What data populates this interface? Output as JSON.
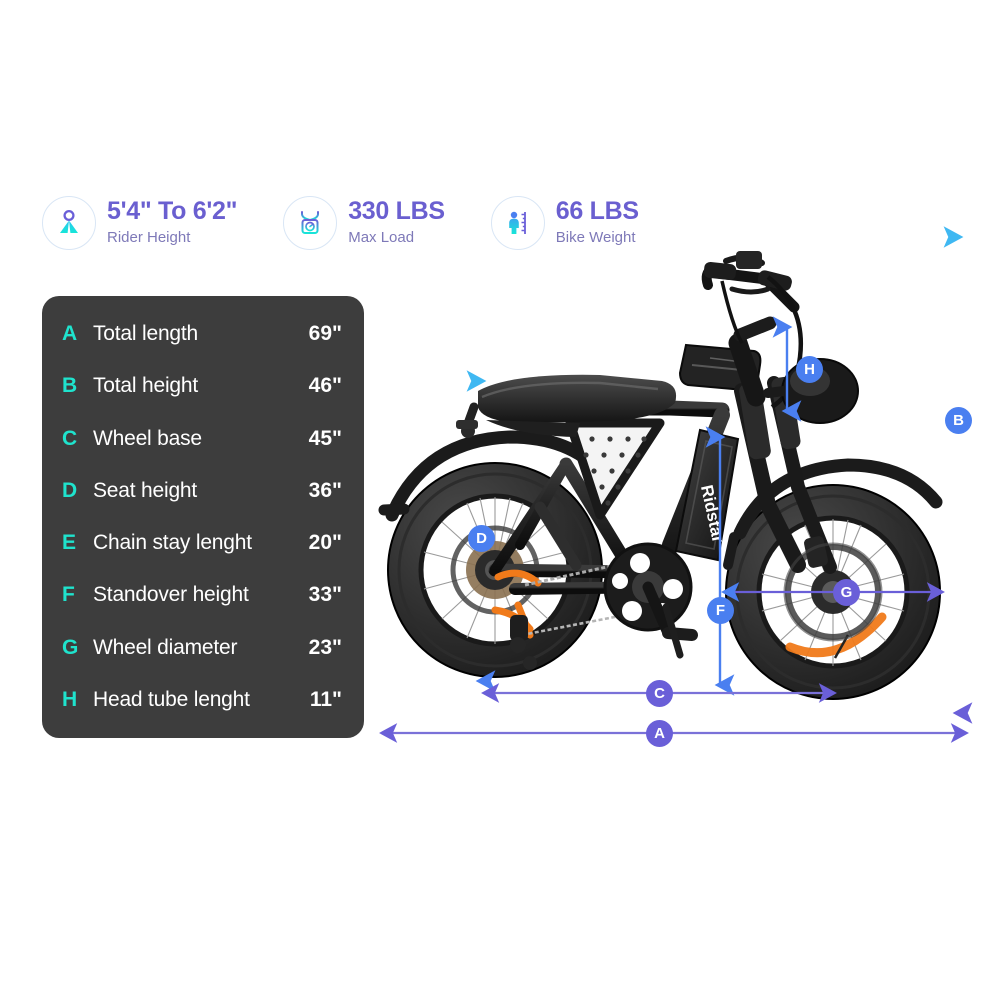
{
  "page": {
    "background": "#ffffff",
    "brand": "Ridstar"
  },
  "stats": [
    {
      "icon": "rider-height-icon",
      "value": "5'4\" To 6'2\"",
      "label": "Rider Height"
    },
    {
      "icon": "max-load-scale-icon",
      "value": "330 LBS",
      "label": "Max Load"
    },
    {
      "icon": "bike-weight-ruler-icon",
      "value": "66 LBS",
      "label": "Bike Weight"
    }
  ],
  "spec_card": {
    "background": "#3d3d3d",
    "letter_color": "#1fe3cd",
    "rows": [
      {
        "letter": "A",
        "name": "Total length",
        "value": "69\""
      },
      {
        "letter": "B",
        "name": "Total height",
        "value": "46\""
      },
      {
        "letter": "C",
        "name": "Wheel base",
        "value": "45\""
      },
      {
        "letter": "D",
        "name": "Seat height",
        "value": "36\""
      },
      {
        "letter": "E",
        "name": "Chain stay lenght",
        "value": "20\""
      },
      {
        "letter": "F",
        "name": "Standover height",
        "value": "33\""
      },
      {
        "letter": "G",
        "name": "Wheel diameter",
        "value": "23\""
      },
      {
        "letter": "H",
        "name": "Head tube lenght",
        "value": "11\""
      }
    ]
  },
  "diagram": {
    "product_label": "Ridstar",
    "markers": [
      {
        "id": "A",
        "color": "#6a5fd8",
        "orientation": "horizontal",
        "description": "total length"
      },
      {
        "id": "B",
        "color": "#4a7ff0",
        "orientation": "vertical",
        "description": "total height"
      },
      {
        "id": "C",
        "color": "#6a5fd8",
        "orientation": "horizontal",
        "description": "wheel base"
      },
      {
        "id": "D",
        "color": "#4a7ff0",
        "orientation": "vertical",
        "description": "seat height"
      },
      {
        "id": "F",
        "color": "#4a7ff0",
        "orientation": "vertical",
        "description": "standover height"
      },
      {
        "id": "G",
        "color": "#6a5fd8",
        "orientation": "horizontal",
        "description": "wheel diameter"
      },
      {
        "id": "H",
        "color": "#4a7ff0",
        "orientation": "vertical",
        "description": "head tube lenght"
      }
    ]
  },
  "colors": {
    "accent_purple": "#6a5fd8",
    "accent_blue": "#4a7ff0",
    "accent_cyan": "#1fe3cd",
    "card_dark": "#3d3d3d",
    "stat_value": "#6a5fd0",
    "stat_label": "#7e79b8"
  }
}
